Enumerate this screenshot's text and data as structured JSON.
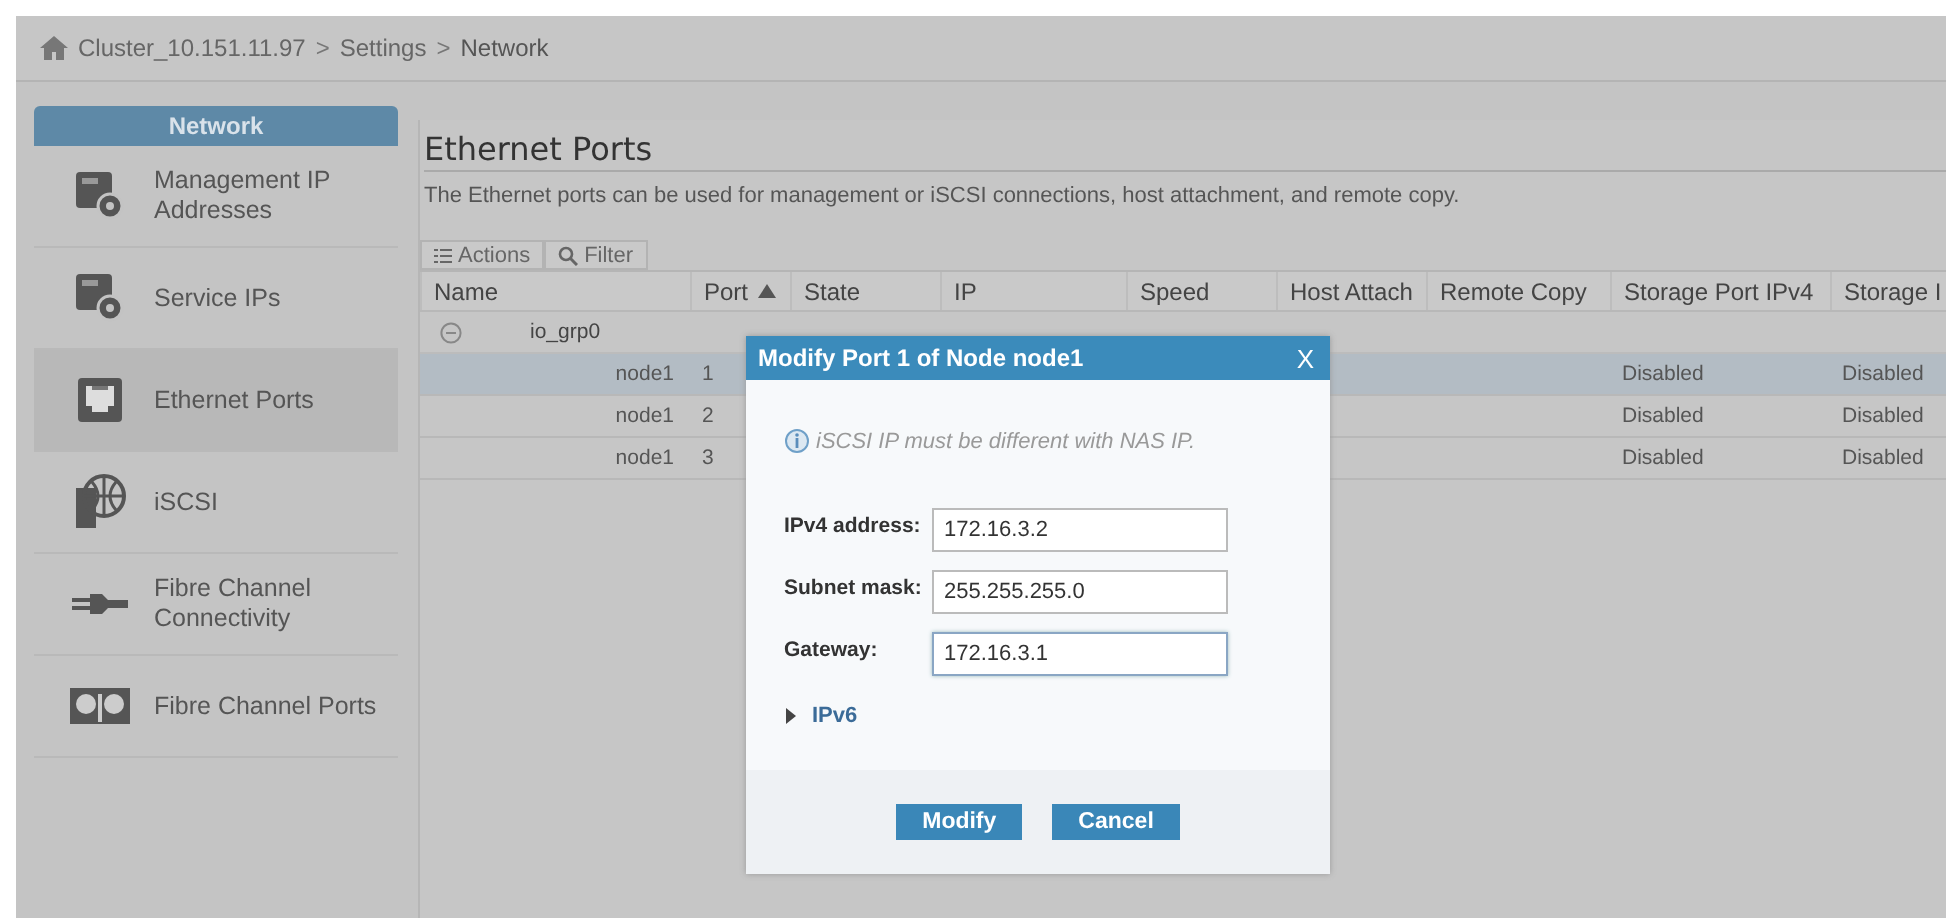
{
  "breadcrumb": {
    "items": [
      "Cluster_10.151.11.97",
      "Settings",
      "Network"
    ],
    "separators": [
      ">",
      ">"
    ]
  },
  "sidebar": {
    "title": "Network",
    "items": [
      {
        "label": "Management IP Addresses",
        "kind": "server-gear",
        "selected": false
      },
      {
        "label": "Service IPs",
        "kind": "server-gear",
        "selected": false
      },
      {
        "label": "Ethernet Ports",
        "kind": "ethernet",
        "selected": true
      },
      {
        "label": "iSCSI",
        "kind": "globe",
        "selected": false
      },
      {
        "label": "Fibre Channel Connectivity",
        "kind": "plug",
        "selected": false
      },
      {
        "label": "Fibre Channel Ports",
        "kind": "ports",
        "selected": false
      }
    ]
  },
  "page": {
    "title": "Ethernet Ports",
    "description": "The Ethernet ports can be used for management or iSCSI connections, host attachment, and remote copy."
  },
  "toolbar": [
    {
      "label": "Actions",
      "kind": "menu"
    },
    {
      "label": "Filter",
      "kind": "search"
    }
  ],
  "table": {
    "columns": [
      {
        "label": "Name",
        "sorted": false
      },
      {
        "label": "Port",
        "sorted": true
      },
      {
        "label": "State",
        "sorted": false
      },
      {
        "label": "IP",
        "sorted": false
      },
      {
        "label": "Speed",
        "sorted": false
      },
      {
        "label": "Host Attach",
        "sorted": false
      },
      {
        "label": "Remote Copy",
        "sorted": false
      },
      {
        "label": "Storage Port IPv4",
        "sorted": false
      },
      {
        "label": "Storage I",
        "sorted": false
      }
    ],
    "group": {
      "label": "io_grp0",
      "expanded": true
    },
    "rows": [
      {
        "name": "node1",
        "port": "1",
        "storage_port_ipv4": "Disabled",
        "column_9": "Disabled",
        "selected": true
      },
      {
        "name": "node1",
        "port": "2",
        "storage_port_ipv4": "Disabled",
        "column_9": "Disabled",
        "selected": false
      },
      {
        "name": "node1",
        "port": "3",
        "storage_port_ipv4": "Disabled",
        "column_9": "Disabled",
        "selected": false
      }
    ]
  },
  "dialog": {
    "title": "Modify Port 1 of Node node1",
    "close": "X",
    "info": "iSCSI IP must be different with NAS IP.",
    "fields": [
      {
        "label": "IPv4 address:",
        "value": "172.16.3.2",
        "focused": false
      },
      {
        "label": "Subnet mask:",
        "value": "255.255.255.0",
        "focused": false
      },
      {
        "label": "Gateway:",
        "value": "172.16.3.1",
        "focused": true
      }
    ],
    "ipv6": {
      "label": "IPv6",
      "expanded": false
    },
    "buttons": [
      "Modify",
      "Cancel"
    ]
  }
}
